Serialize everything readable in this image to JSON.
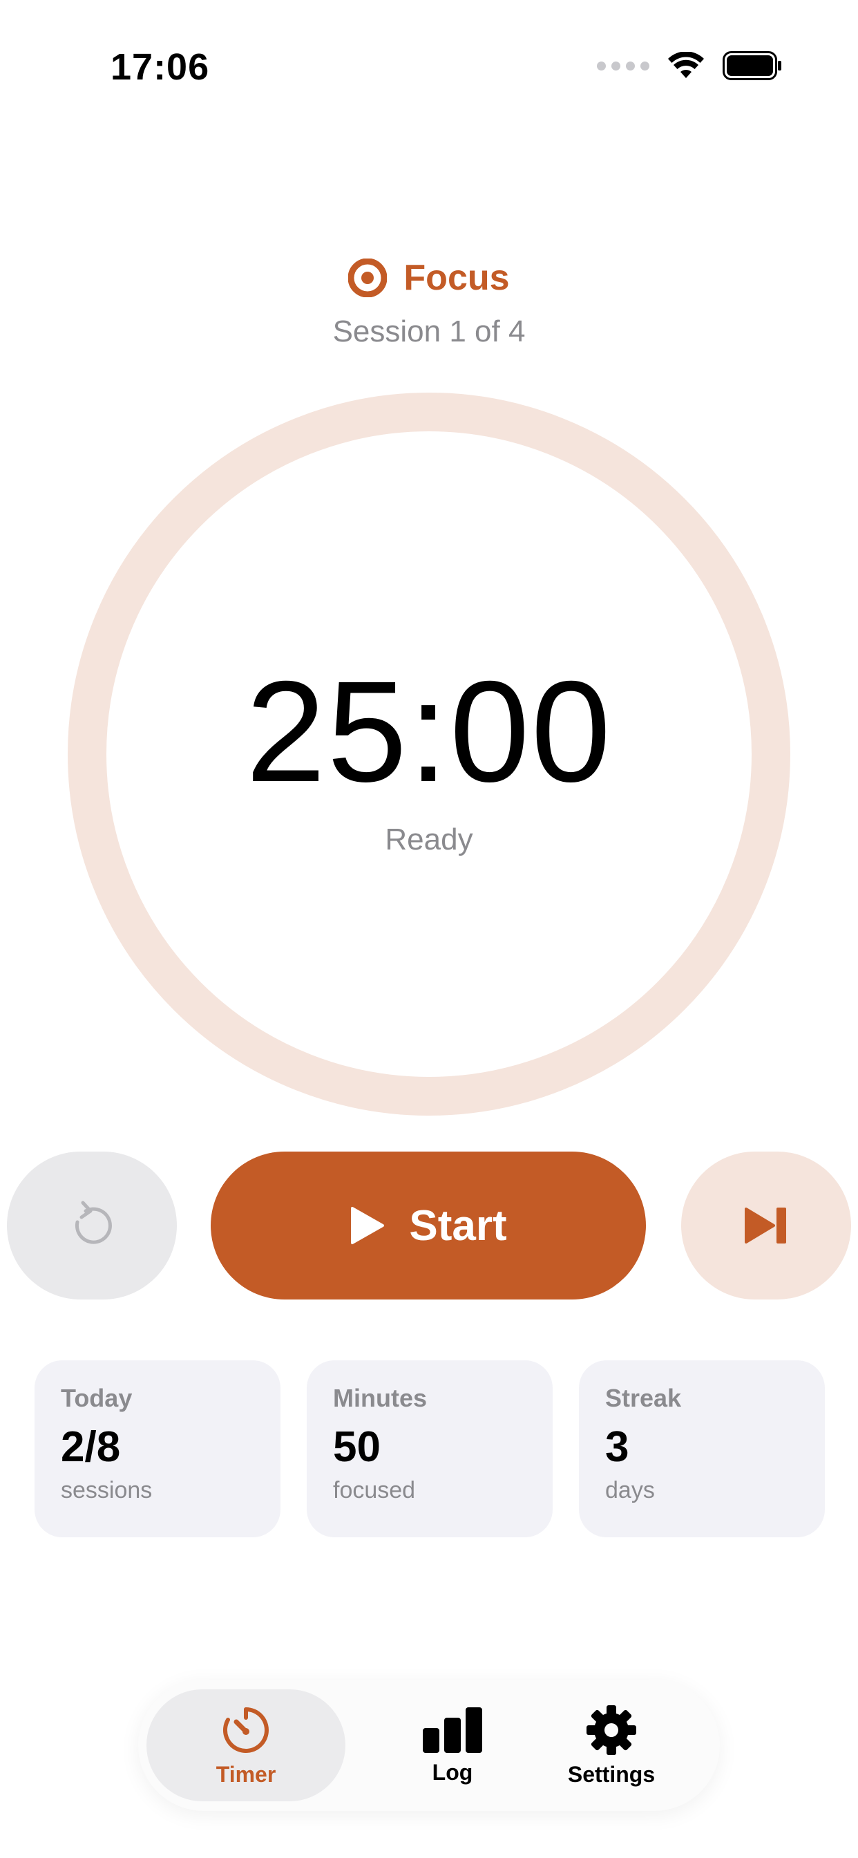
{
  "status_bar": {
    "time": "17:06"
  },
  "header": {
    "mode_label": "Focus",
    "session_text": "Session 1 of 4"
  },
  "timer": {
    "time": "25:00",
    "state": "Ready",
    "progress": 0
  },
  "controls": {
    "start_label": "Start"
  },
  "stats": [
    {
      "title": "Today",
      "value": "2/8",
      "subtitle": "sessions"
    },
    {
      "title": "Minutes",
      "value": "50",
      "subtitle": "focused"
    },
    {
      "title": "Streak",
      "value": "3",
      "subtitle": "days"
    }
  ],
  "tabs": [
    {
      "label": "Timer",
      "icon": "timer-icon",
      "selected": true
    },
    {
      "label": "Log",
      "icon": "bar-chart-icon",
      "selected": false
    },
    {
      "label": "Settings",
      "icon": "gear-icon",
      "selected": false
    }
  ],
  "colors": {
    "accent": "#c35b26",
    "ring_track": "#f5e4dc",
    "secondary_text": "#8a8a8e",
    "card_background": "#f2f2f7"
  }
}
